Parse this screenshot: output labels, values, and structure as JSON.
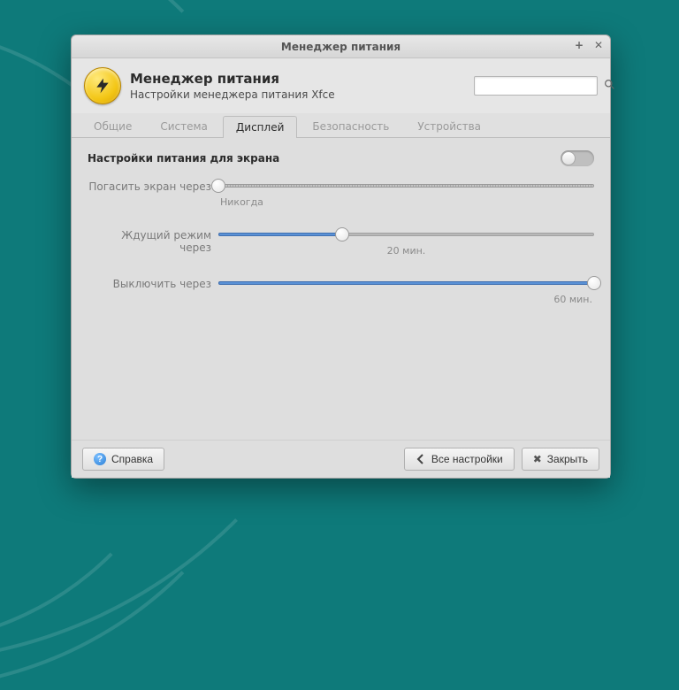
{
  "window": {
    "title": "Менеджер питания"
  },
  "header": {
    "title": "Менеджер питания",
    "subtitle": "Настройки менеджера питания Xfce",
    "search_placeholder": ""
  },
  "tabs": {
    "general": "Общие",
    "system": "Система",
    "display": "Дисплей",
    "security": "Безопасность",
    "devices": "Устройства",
    "active_index": 2
  },
  "section": {
    "title": "Настройки питания для экрана",
    "toggle_on": false
  },
  "sliders": {
    "blank": {
      "label": "Погасить экран через",
      "percent": 0,
      "caption": "Никогда"
    },
    "suspend": {
      "label": "Ждущий режим через",
      "percent": 33,
      "caption": "20 мин."
    },
    "off": {
      "label": "Выключить через",
      "percent": 100,
      "caption": "60 мин."
    }
  },
  "footer": {
    "help": "Справка",
    "all_settings": "Все настройки",
    "close": "Закрыть"
  }
}
